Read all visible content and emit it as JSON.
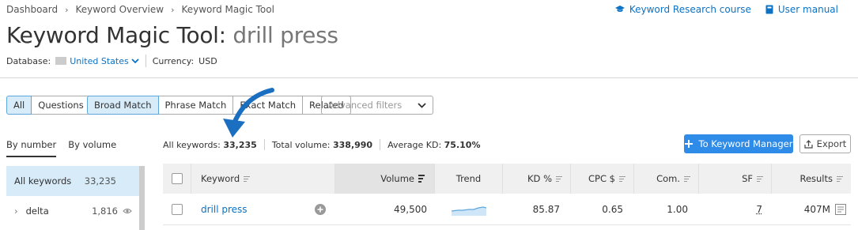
{
  "breadcrumb": [
    "Dashboard",
    "Keyword Overview",
    "Keyword Magic Tool"
  ],
  "toplinks": {
    "course": "Keyword Research course",
    "manual": "User manual"
  },
  "title": {
    "tool": "Keyword Magic Tool:",
    "query": "drill press"
  },
  "meta": {
    "database_label": "Database:",
    "country": "United States",
    "currency_label": "Currency:",
    "currency": "USD"
  },
  "match_tabs": [
    "All",
    "Questions"
  ],
  "type_tabs": [
    "Broad Match",
    "Phrase Match",
    "Exact Match",
    "Related"
  ],
  "advanced_filters": "Advanced filters",
  "sort_tabs": [
    "By number",
    "By volume"
  ],
  "sidebar": [
    {
      "label": "All keywords",
      "count": "33,235"
    },
    {
      "label": "delta",
      "count": "1,816"
    }
  ],
  "stats": {
    "all_label": "All keywords:",
    "all_value": "33,235",
    "vol_label": "Total volume:",
    "vol_value": "338,990",
    "kd_label": "Average KD:",
    "kd_value": "75.10%"
  },
  "buttons": {
    "keyword_manager": "To Keyword Manager",
    "export": "Export"
  },
  "columns": [
    "Keyword",
    "Volume",
    "Trend",
    "KD %",
    "CPC $",
    "Com.",
    "SF",
    "Results"
  ],
  "rows": [
    {
      "keyword": "drill press",
      "volume": "49,500",
      "kd": "85.87",
      "cpc": "0.65",
      "com": "1.00",
      "sf": "7",
      "results": "407M"
    }
  ],
  "colors": {
    "accent": "#0b72c4",
    "button": "#2e8be7",
    "selected": "#d7ebf9"
  }
}
